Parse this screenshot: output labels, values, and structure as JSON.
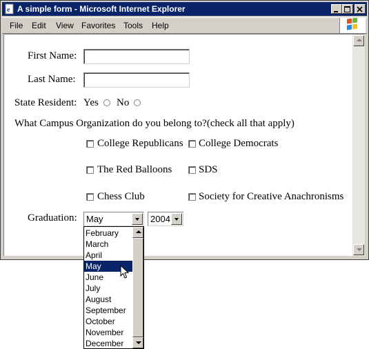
{
  "window": {
    "title": "A simple form - Microsoft Internet Explorer"
  },
  "menu": [
    "File",
    "Edit",
    "View",
    "Favorites",
    "Tools",
    "Help"
  ],
  "form": {
    "first_name_label": "First Name:",
    "first_name_value": "",
    "last_name_label": "Last Name:",
    "last_name_value": "",
    "state_resident_label": "State Resident:",
    "yes_label": "Yes",
    "no_label": "No",
    "campus_question": "What Campus Organization do you belong to?(check all that apply)",
    "organizations": [
      "College Republicans",
      "College Democrats",
      "The Red Balloons",
      "SDS",
      "Chess Club",
      "Society for Creative Anachronisms"
    ],
    "graduation_label": "Graduation:",
    "month_value": "May",
    "year_value": "2004"
  },
  "dropdown": {
    "options": [
      "February",
      "March",
      "April",
      "May",
      "June",
      "July",
      "August",
      "September",
      "October",
      "November",
      "December"
    ],
    "selected": "May"
  },
  "colors": {
    "titlebar": "#0a246a",
    "selection": "#0a246a",
    "chrome": "#d4d0c8"
  }
}
